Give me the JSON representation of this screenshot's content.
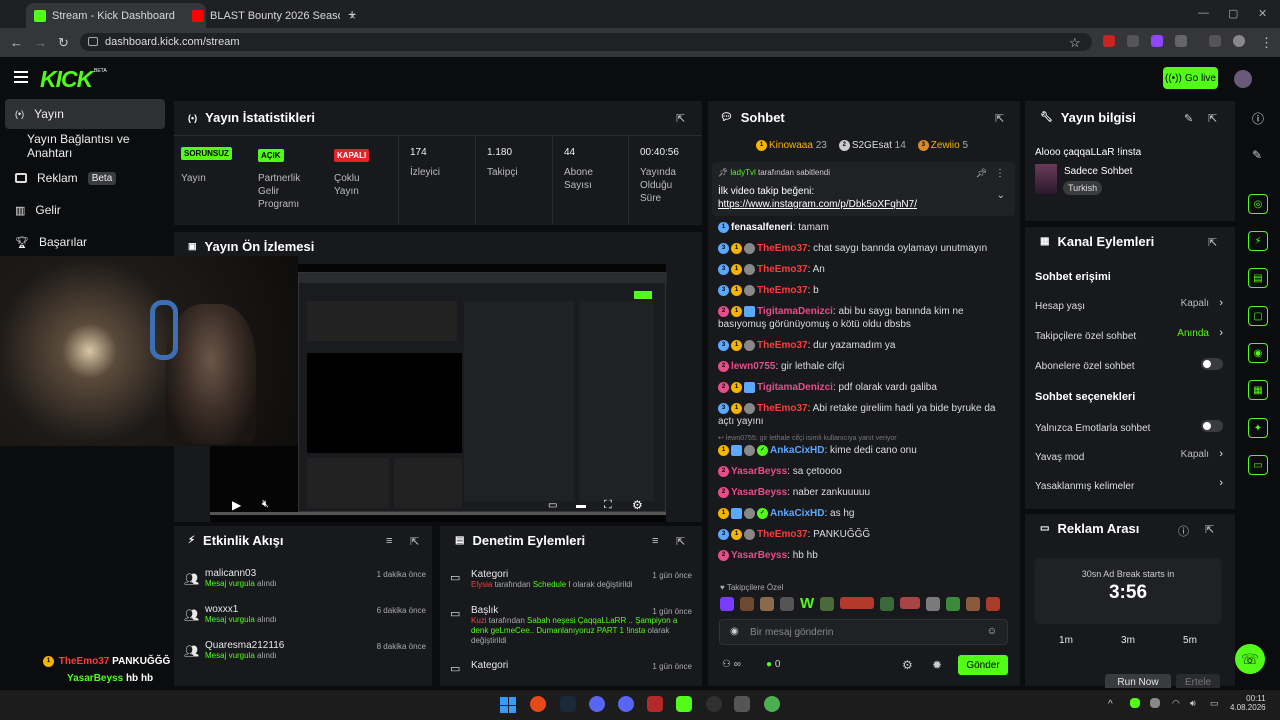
{
  "browser": {
    "tabs": [
      {
        "title": "Stream - Kick Dashboard",
        "active": true
      },
      {
        "title": "BLAST Bounty 2026 Season 2 - ",
        "active": false
      }
    ],
    "url": "dashboard.kick.com/stream"
  },
  "header": {
    "logo": "KICK",
    "logo_sup": "BETA",
    "go_live": "Go live"
  },
  "sidebar": {
    "items": [
      {
        "label": "Yayın",
        "icon": "broadcast-icon",
        "active": true
      },
      {
        "label": "Yayın Bağlantısı ve Anahtarı",
        "icon": "",
        "active": false
      },
      {
        "label": "Reklam",
        "icon": "ad-icon",
        "badge": "Beta"
      },
      {
        "label": "Gelir",
        "icon": "chart-icon"
      },
      {
        "label": "Başarılar",
        "icon": "trophy-icon"
      }
    ]
  },
  "stats": {
    "title": "Yayın İstatistikleri",
    "items": [
      {
        "badge": "SORUNSUZ",
        "label": "Yayın",
        "color": "#53fc18"
      },
      {
        "badge": "AÇIK",
        "label": "Partnerlik Gelir Programı",
        "color": "#53fc18"
      },
      {
        "badge": "KAPALI",
        "label": "Çoklu Yayın",
        "color": "#e8202a"
      },
      {
        "value": "174",
        "label": "İzleyici"
      },
      {
        "value": "1.180",
        "label": "Takipçi"
      },
      {
        "value": "44",
        "label": "Abone Sayısı"
      },
      {
        "value": "00:40:56",
        "label": "Yayında Olduğu Süre"
      }
    ]
  },
  "preview": {
    "title": "Yayın Ön İzlemesi"
  },
  "overlay_chat": [
    {
      "user": "TheEmo37",
      "text": "PANKUĞĞĞ"
    },
    {
      "user": "YasarBeyss",
      "text": "hb hb"
    }
  ],
  "activity": {
    "title": "Etkinlik Akışı",
    "items": [
      {
        "user": "malicann03",
        "action": "Mesaj vurgula",
        "suffix": "alındı",
        "time": "1 dakika önce"
      },
      {
        "user": "woxxx1",
        "action": "Mesaj vurgula",
        "suffix": "alındı",
        "time": "6 dakika önce"
      },
      {
        "user": "Quaresma212116",
        "action": "Mesaj vurgula",
        "suffix": "alındı",
        "time": "8 dakika önce"
      }
    ]
  },
  "moderation": {
    "title": "Denetim Eylemleri",
    "items": [
      {
        "title": "Kategori",
        "time": "1 gün önce",
        "detail_user": "Elysia",
        "detail": " tarafından ",
        "detail_hl": "Schedule I",
        "detail_end": " olarak değiştirildi"
      },
      {
        "title": "Başlık",
        "time": "1 gün önce",
        "detail_user": "Kuzi",
        "detail": " tarafından ",
        "detail_hl": "Sabah neşesi ÇaqqaLLaRR .. Şampiyon a denk geLmeCee.. Dumanlanıyoruz PART 1 !insta",
        "detail_end": " olarak değiştirildi"
      },
      {
        "title": "Kategori",
        "time": "1 gün önce",
        "detail_user": "",
        "detail": "",
        "detail_hl": "",
        "detail_end": ""
      }
    ]
  },
  "chat": {
    "title": "Sohbet",
    "top_gifters": [
      {
        "name": "Kinowaaa",
        "count": "23"
      },
      {
        "name": "S2GEsat",
        "count": "14"
      },
      {
        "name": "Zewiio",
        "count": "5"
      }
    ],
    "pinned": {
      "by": "ladyTvl",
      "by_suffix": "tarafından sabitlendi",
      "text": "İlk video takip beğeni:",
      "link": "https://www.instagram.com/p/Dbk5oXFqhN7/"
    },
    "messages": [
      {
        "user": "fenasalfeneri",
        "color": "#ffffff",
        "text": "tamam"
      },
      {
        "user": "TheEmo37",
        "color": "#ff3c3c",
        "text": "chat saygı bannda oylamayı unutmayın"
      },
      {
        "user": "TheEmo37",
        "color": "#ff3c3c",
        "text": "An"
      },
      {
        "user": "TheEmo37",
        "color": "#ff3c3c",
        "text": "b"
      },
      {
        "user": "TigitamaDenizci",
        "color": "#e74c8b",
        "text": "abi bu saygı banında kim ne basıyomuş görünüyomuş o kötü oldu dbsbs"
      },
      {
        "user": "TheEmo37",
        "color": "#ff3c3c",
        "text": "dur yazamadım ya"
      },
      {
        "user": "lewn0755",
        "color": "#e74c8b",
        "text": "gir lethale cifçi"
      },
      {
        "user": "TigitamaDenizci",
        "color": "#e74c8b",
        "text": "pdf olarak vardı galiba"
      },
      {
        "user": "TheEmo37",
        "color": "#ff3c3c",
        "text": "Abi retake gireliim hadi ya bide byruke da açtı yayını"
      },
      {
        "user": "AnkaCixHD",
        "color": "#5ba8ff",
        "text": "kime dedi cano onu",
        "reply": "lewn0755: gir lethale cifçi isimli kullanıcıya yanıt veriyor"
      },
      {
        "user": "YasarBeyss",
        "color": "#e74c8b",
        "text": "sa çetoooo"
      },
      {
        "user": "YasarBeyss",
        "color": "#e74c8b",
        "text": "naber zankuuuuu"
      },
      {
        "user": "AnkaCixHD",
        "color": "#5ba8ff",
        "text": "as hg"
      },
      {
        "user": "TheEmo37",
        "color": "#ff3c3c",
        "text": "PANKUĞĞĞ"
      },
      {
        "user": "YasarBeyss",
        "color": "#e74c8b",
        "text": "hb hb"
      }
    ],
    "emote_label": "Takipçilere Özel",
    "input_placeholder": "Bir mesaj gönderin",
    "count_label": "0",
    "send": "Gönder"
  },
  "stream_info": {
    "title": "Yayın bilgisi",
    "stream_title": "Alooo çaqqaLLaR !insta",
    "category": "Sadece Sohbet",
    "language": "Turkish"
  },
  "channel_actions": {
    "title": "Kanal Eylemleri",
    "access_header": "Sohbet erişimi",
    "rows": [
      {
        "label": "Hesap yaşı",
        "value": "Kapalı",
        "type": "select"
      },
      {
        "label": "Takipçilere özel sohbet",
        "value": "Anında",
        "type": "select-green"
      },
      {
        "label": "Abonelere özel sohbet",
        "value": "",
        "type": "toggle"
      }
    ],
    "options_header": "Sohbet seçenekleri",
    "rows2": [
      {
        "label": "Yalnızca Emotlarla sohbet",
        "value": "",
        "type": "toggle"
      },
      {
        "label": "Yavaş mod",
        "value": "Kapalı",
        "type": "select"
      },
      {
        "label": "Yasaklanmış kelimeler",
        "value": "",
        "type": "select"
      }
    ]
  },
  "ad_break": {
    "title": "Reklam Arası",
    "label": "30sn Ad Break starts in",
    "countdown": "3:56",
    "options": [
      "1m",
      "3m",
      "5m"
    ],
    "run_now": "Run Now",
    "delay": "Ertele"
  },
  "taskbar": {
    "time": "00:11",
    "date": "4.08.2026"
  }
}
